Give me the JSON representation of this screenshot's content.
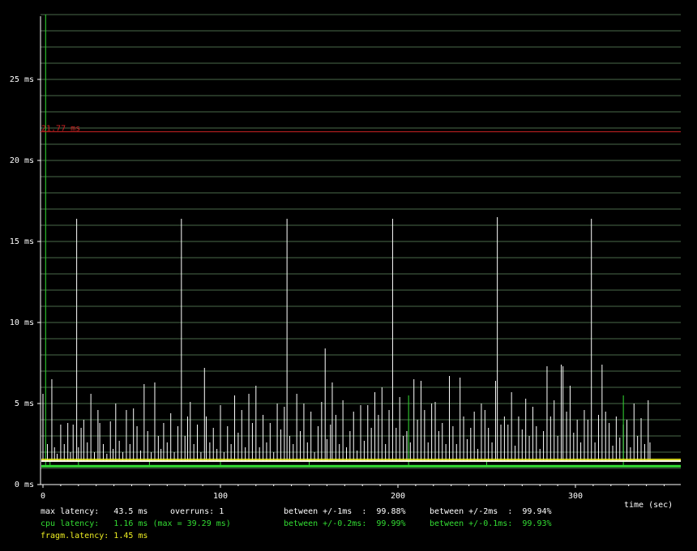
{
  "colors": {
    "background": "#000000",
    "grid": "#4a6a4a",
    "axis": "#ffffff",
    "total_latency": "#ffffff",
    "cpu_latency": "#33dd33",
    "fragm_latency": "#eeee22",
    "threshold": "#cc2222"
  },
  "chart_data": {
    "type": "line",
    "title": "",
    "xlabel": "time (sec)",
    "ylabel": "",
    "xlim": [
      0,
      360
    ],
    "ylim": [
      0,
      29
    ],
    "grid": true,
    "x_ticks": [
      0,
      100,
      200,
      300
    ],
    "y_ticks": [
      {
        "value": 0,
        "label": "0 ms"
      },
      {
        "value": 5,
        "label": "5 ms"
      },
      {
        "value": 10,
        "label": "10 ms"
      },
      {
        "value": 15,
        "label": "15 ms"
      },
      {
        "value": 20,
        "label": "20 ms"
      },
      {
        "value": 25,
        "label": "25 ms"
      }
    ],
    "threshold": {
      "value": 21.77,
      "label": "21.77 ms"
    },
    "baselines": {
      "total_latency": 1.45,
      "cpu_latency": 1.16,
      "fragm_latency": 1.45
    },
    "series": [
      {
        "key": "total_latency",
        "points": [
          [
            0,
            5.6
          ],
          [
            2.5,
            2.5
          ],
          [
            5,
            6.5
          ],
          [
            6.5,
            2.3
          ],
          [
            8,
            1.9
          ],
          [
            10,
            3.7
          ],
          [
            12,
            2.5
          ],
          [
            14,
            3.8
          ],
          [
            15.5,
            2.0
          ],
          [
            17,
            3.7
          ],
          [
            19,
            16.4
          ],
          [
            20,
            2.3
          ],
          [
            21.5,
            3.5
          ],
          [
            23,
            4.0
          ],
          [
            25,
            2.6
          ],
          [
            27,
            5.6
          ],
          [
            29,
            2.0
          ],
          [
            31,
            4.6
          ],
          [
            32,
            3.8
          ],
          [
            34,
            2.5
          ],
          [
            36,
            1.9
          ],
          [
            38,
            3.9
          ],
          [
            39.5,
            2.2
          ],
          [
            41,
            5.0
          ],
          [
            43,
            2.7
          ],
          [
            45,
            2.0
          ],
          [
            47,
            4.6
          ],
          [
            49,
            2.5
          ],
          [
            51,
            4.7
          ],
          [
            53,
            3.6
          ],
          [
            55,
            2.1
          ],
          [
            57,
            6.2
          ],
          [
            59,
            3.3
          ],
          [
            61,
            2.0
          ],
          [
            63,
            6.3
          ],
          [
            65,
            3.0
          ],
          [
            66.5,
            2.2
          ],
          [
            68,
            3.8
          ],
          [
            70,
            2.6
          ],
          [
            72,
            4.4
          ],
          [
            74,
            2.0
          ],
          [
            76,
            3.6
          ],
          [
            78,
            16.4
          ],
          [
            80,
            3.0
          ],
          [
            81.5,
            4.2
          ],
          [
            83,
            5.1
          ],
          [
            85,
            2.5
          ],
          [
            87,
            3.7
          ],
          [
            89,
            2.0
          ],
          [
            91,
            7.2
          ],
          [
            92,
            4.2
          ],
          [
            94,
            2.6
          ],
          [
            96,
            3.5
          ],
          [
            98,
            2.2
          ],
          [
            100,
            4.9
          ],
          [
            102,
            2.0
          ],
          [
            104,
            3.6
          ],
          [
            106,
            2.5
          ],
          [
            108,
            5.5
          ],
          [
            110,
            3.2
          ],
          [
            112,
            4.6
          ],
          [
            114,
            2.3
          ],
          [
            116,
            5.6
          ],
          [
            118,
            3.8
          ],
          [
            120,
            6.1
          ],
          [
            122,
            2.3
          ],
          [
            124,
            4.3
          ],
          [
            126,
            2.6
          ],
          [
            128,
            3.8
          ],
          [
            130,
            2.0
          ],
          [
            132,
            5.0
          ],
          [
            134,
            3.4
          ],
          [
            136,
            4.8
          ],
          [
            137.5,
            16.4
          ],
          [
            139,
            3.0
          ],
          [
            141,
            2.5
          ],
          [
            143,
            5.6
          ],
          [
            145,
            3.3
          ],
          [
            147,
            5.0
          ],
          [
            149,
            2.6
          ],
          [
            151,
            4.5
          ],
          [
            153,
            2.0
          ],
          [
            155,
            3.6
          ],
          [
            157,
            5.1
          ],
          [
            159,
            8.4
          ],
          [
            160,
            2.8
          ],
          [
            162,
            3.7
          ],
          [
            163,
            6.3
          ],
          [
            165,
            4.3
          ],
          [
            167,
            2.5
          ],
          [
            169,
            5.2
          ],
          [
            171,
            2.3
          ],
          [
            173,
            3.3
          ],
          [
            175,
            4.5
          ],
          [
            177,
            2.1
          ],
          [
            179,
            4.9
          ],
          [
            181,
            2.7
          ],
          [
            183,
            4.9
          ],
          [
            185,
            3.5
          ],
          [
            187,
            5.7
          ],
          [
            189,
            4.3
          ],
          [
            191,
            6.0
          ],
          [
            193,
            2.5
          ],
          [
            195,
            4.6
          ],
          [
            197,
            16.4
          ],
          [
            199,
            3.5
          ],
          [
            201,
            5.4
          ],
          [
            203,
            3.0
          ],
          [
            205,
            3.3
          ],
          [
            207,
            2.6
          ],
          [
            209,
            6.5
          ],
          [
            211,
            4.0
          ],
          [
            213,
            6.4
          ],
          [
            215,
            4.6
          ],
          [
            217,
            2.6
          ],
          [
            219,
            5.0
          ],
          [
            221,
            5.1
          ],
          [
            223,
            3.3
          ],
          [
            225,
            3.8
          ],
          [
            227,
            2.5
          ],
          [
            229,
            6.7
          ],
          [
            231,
            3.6
          ],
          [
            233,
            2.5
          ],
          [
            235,
            6.6
          ],
          [
            237,
            4.2
          ],
          [
            239,
            2.8
          ],
          [
            241,
            3.5
          ],
          [
            243,
            4.5
          ],
          [
            245,
            2.2
          ],
          [
            247,
            5.0
          ],
          [
            249,
            4.6
          ],
          [
            251,
            3.5
          ],
          [
            253,
            2.6
          ],
          [
            255,
            6.4
          ],
          [
            256,
            16.5
          ],
          [
            258,
            3.7
          ],
          [
            260,
            4.2
          ],
          [
            262,
            3.7
          ],
          [
            264,
            5.7
          ],
          [
            266,
            2.4
          ],
          [
            268,
            4.2
          ],
          [
            270,
            3.4
          ],
          [
            272,
            5.3
          ],
          [
            274,
            3.0
          ],
          [
            276,
            4.8
          ],
          [
            278,
            3.6
          ],
          [
            280,
            2.2
          ],
          [
            282,
            3.3
          ],
          [
            284,
            7.3
          ],
          [
            286,
            4.2
          ],
          [
            288,
            5.2
          ],
          [
            290,
            3.0
          ],
          [
            292,
            7.4
          ],
          [
            293,
            7.3
          ],
          [
            295,
            4.5
          ],
          [
            297,
            6.1
          ],
          [
            299,
            3.2
          ],
          [
            301,
            4.0
          ],
          [
            303,
            2.6
          ],
          [
            305,
            4.6
          ],
          [
            307,
            4.0
          ],
          [
            309,
            16.4
          ],
          [
            311,
            2.6
          ],
          [
            313,
            4.3
          ],
          [
            315,
            7.4
          ],
          [
            317,
            4.5
          ],
          [
            319,
            3.8
          ],
          [
            321,
            2.4
          ],
          [
            323,
            4.2
          ],
          [
            325,
            2.9
          ],
          [
            327,
            3.7
          ],
          [
            329,
            4.0
          ],
          [
            331,
            2.3
          ],
          [
            333,
            5.0
          ],
          [
            335,
            3.0
          ],
          [
            337,
            4.1
          ],
          [
            339,
            2.5
          ],
          [
            341,
            5.2
          ],
          [
            342,
            2.6
          ]
        ]
      },
      {
        "key": "cpu_latency",
        "points": [
          [
            1.5,
            29.0
          ],
          [
            206,
            5.5
          ],
          [
            327,
            5.5
          ],
          [
            4,
            1.6
          ],
          [
            20,
            1.6
          ],
          [
            60,
            1.6
          ],
          [
            100,
            1.6
          ],
          [
            150,
            1.6
          ],
          [
            250,
            1.6
          ]
        ]
      }
    ]
  },
  "stats": {
    "max_latency": "max latency:   43.5 ms",
    "overruns": "overruns: 1",
    "between_1ms": "between +/-1ms  :  99.88%",
    "between_2ms": "between +/-2ms  :  99.94%",
    "cpu_latency": "cpu latency:   1.16 ms (max = 39.29 ms)",
    "between_02ms": "between +/-0.2ms:  99.99%",
    "between_01ms": "between +/-0.1ms:  99.93%",
    "fragm_latency": "fragm.latency: 1.45 ms"
  }
}
